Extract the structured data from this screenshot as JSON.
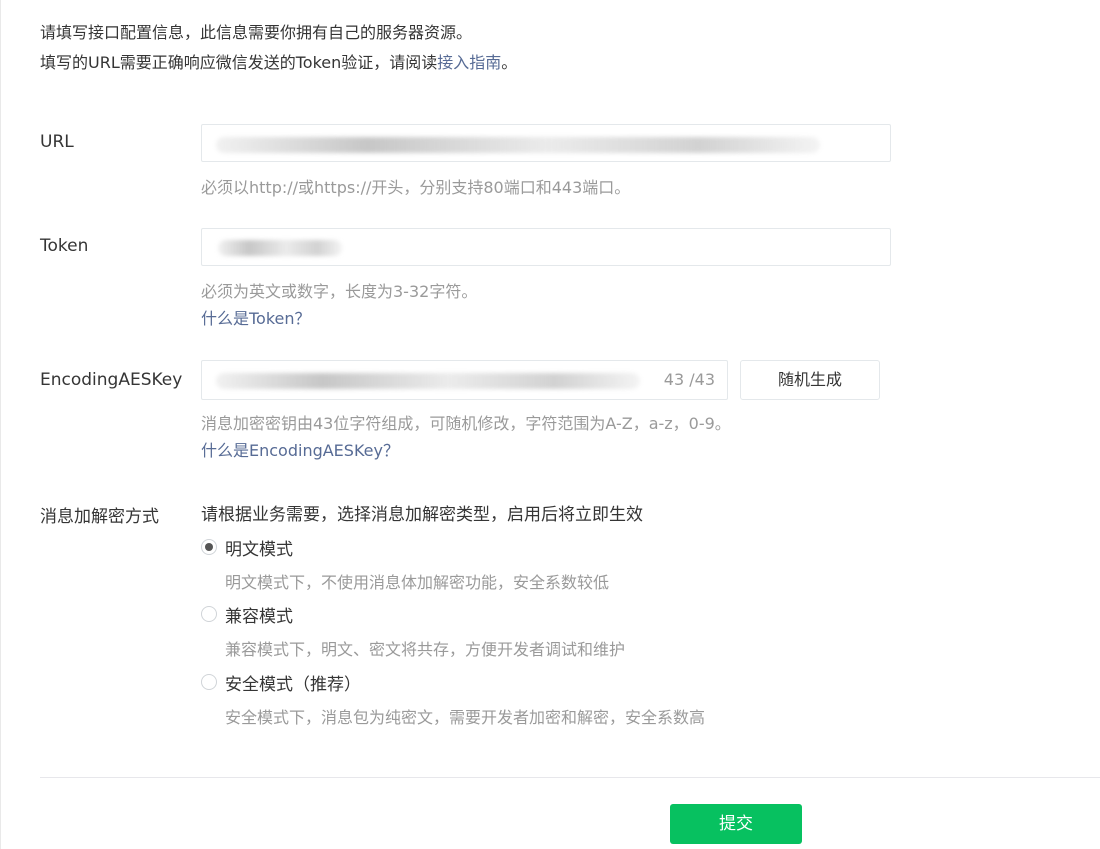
{
  "intro": {
    "line1": "请填写接口配置信息，此信息需要你拥有自己的服务器资源。",
    "line2_prefix": "填写的URL需要正确响应微信发送的Token验证，请阅读",
    "line2_link": "接入指南",
    "line2_suffix": "。"
  },
  "url": {
    "label": "URL",
    "hint": "必须以http://或https://开头，分别支持80端口和443端口。"
  },
  "token": {
    "label": "Token",
    "hint": "必须为英文或数字，长度为3-32字符。",
    "link": "什么是Token？"
  },
  "aeskey": {
    "label": "EncodingAESKey",
    "counter": "43 /43",
    "random_button": "随机生成",
    "hint": "消息加密密钥由43位字符组成，可随机修改，字符范围为A-Z，a-z，0-9。",
    "link": "什么是EncodingAESKey？"
  },
  "encryption": {
    "label": "消息加解密方式",
    "description": "请根据业务需要，选择消息加解密类型，启用后将立即生效",
    "options": [
      {
        "label": "明文模式",
        "desc": "明文模式下，不使用消息体加解密功能，安全系数较低",
        "checked": true
      },
      {
        "label": "兼容模式",
        "desc": "兼容模式下，明文、密文将共存，方便开发者调试和维护",
        "checked": false
      },
      {
        "label": "安全模式（推荐）",
        "desc": "安全模式下，消息包为纯密文，需要开发者加密和解密，安全系数高",
        "checked": false
      }
    ]
  },
  "submit_label": "提交",
  "colors": {
    "accent": "#07c160",
    "link": "#576b95",
    "hint": "#9a9a9a"
  }
}
